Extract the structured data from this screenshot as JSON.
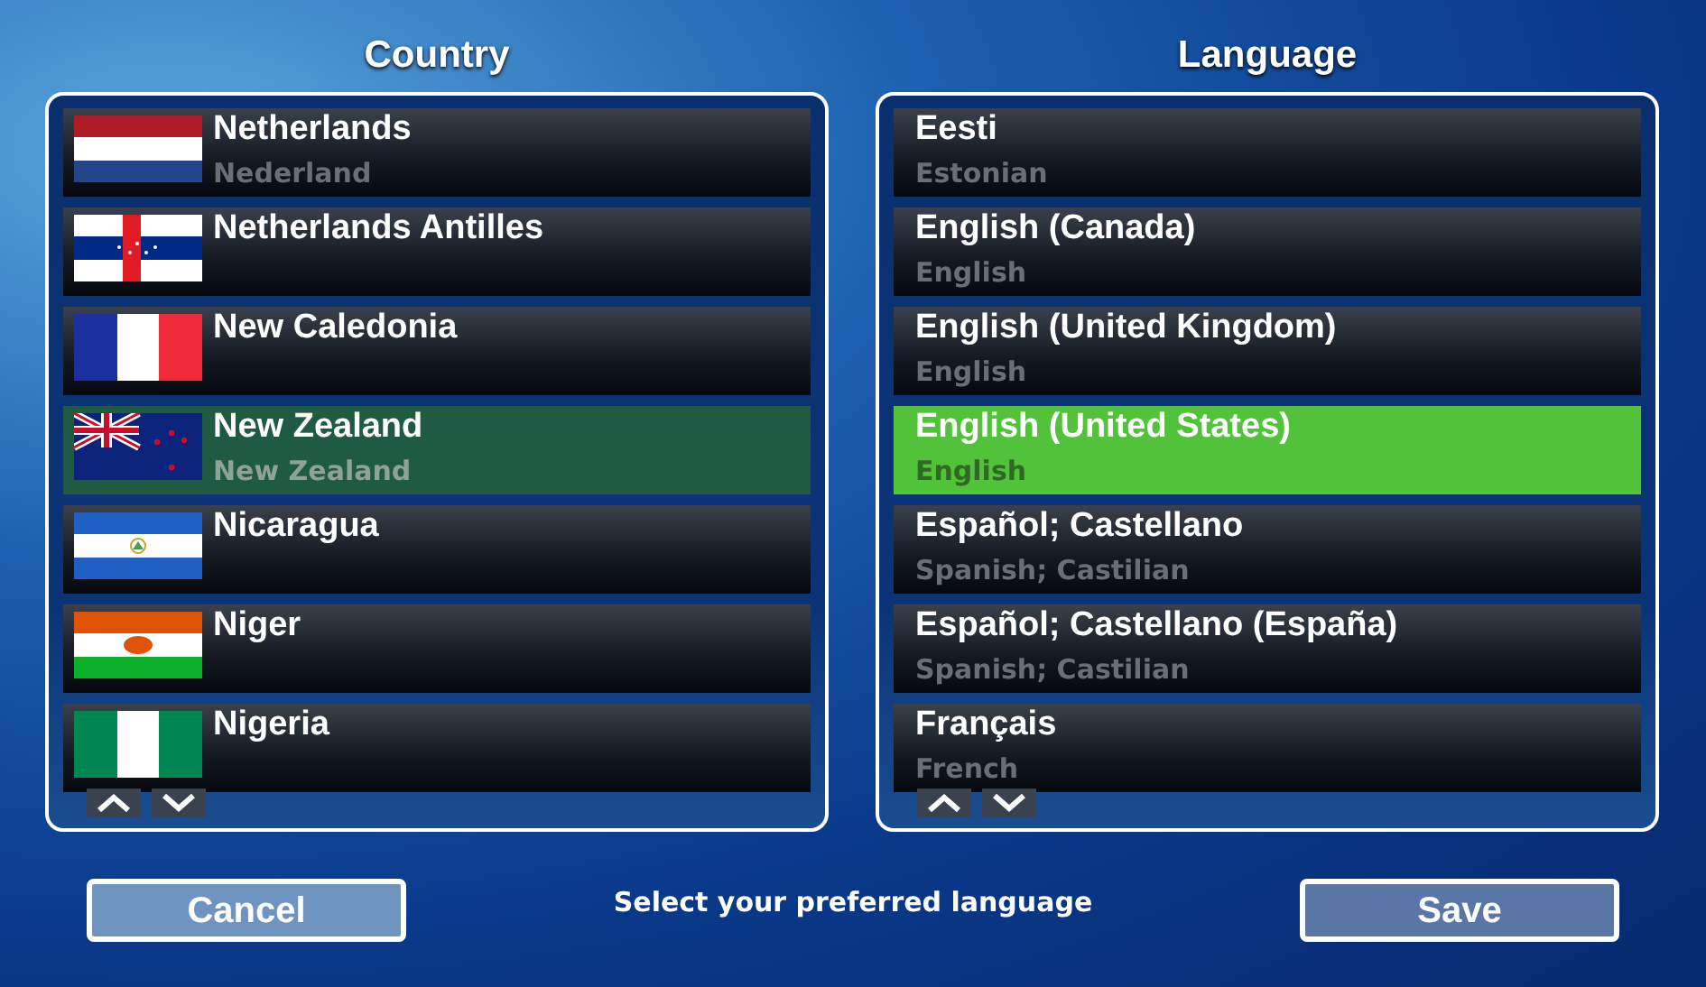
{
  "country_panel": {
    "title": "Country",
    "items": [
      {
        "name": "Netherlands",
        "native": "Nederland",
        "kind": "netherlands",
        "selected": false
      },
      {
        "name": "Netherlands Antilles",
        "kind": "antilles",
        "selected": false
      },
      {
        "name": "New Caledonia",
        "kind": "france",
        "selected": false
      },
      {
        "name": "New Zealand",
        "native": "New Zealand",
        "kind": "new_zealand",
        "selected": true
      },
      {
        "name": "Nicaragua",
        "kind": "nicaragua",
        "selected": false
      },
      {
        "name": "Niger",
        "kind": "niger",
        "selected": false
      },
      {
        "name": "Nigeria",
        "kind": "nigeria",
        "selected": false
      }
    ]
  },
  "language_panel": {
    "title": "Language",
    "items": [
      {
        "name": "Eesti",
        "native": "Estonian",
        "selected": false
      },
      {
        "name": "English (Canada)",
        "native": "English",
        "selected": false
      },
      {
        "name": "English (United Kingdom)",
        "native": "English",
        "selected": false
      },
      {
        "name": "English (United States)",
        "native": "English",
        "selected": true
      },
      {
        "name": "Español; Castellano",
        "native": "Spanish; Castilian",
        "selected": false
      },
      {
        "name": "Español; Castellano (España)",
        "native": "Spanish; Castilian",
        "selected": false
      },
      {
        "name": "Français",
        "native": "French",
        "selected": false
      }
    ]
  },
  "buttons": {
    "cancel": "Cancel",
    "save": "Save"
  },
  "hint": "Select your preferred language"
}
